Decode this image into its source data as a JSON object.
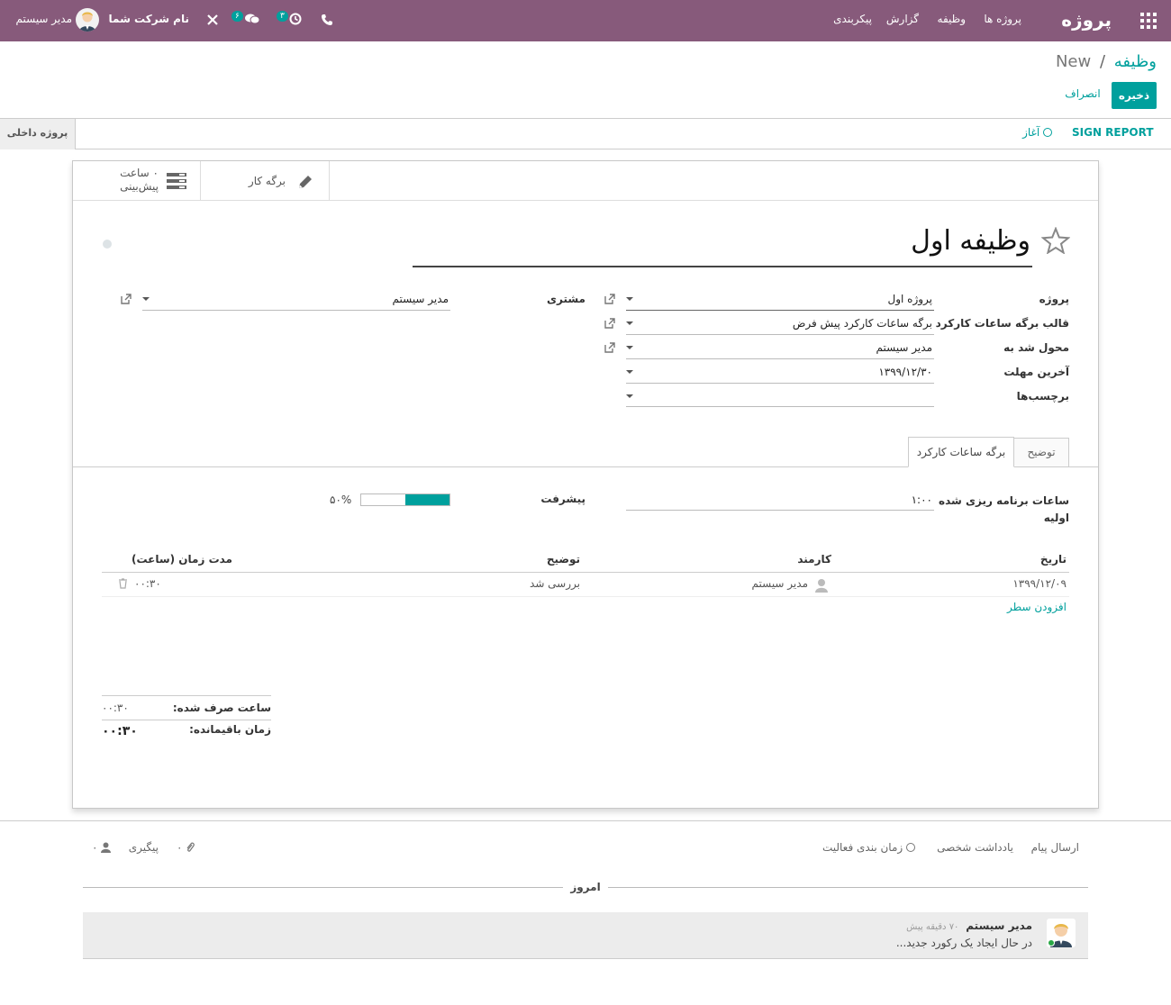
{
  "navbar": {
    "app_title": "پروژه",
    "menu": [
      "پروژه ها",
      "وظیفه",
      "گزارش",
      "پیکربندی"
    ],
    "activity_count": "۳",
    "messages_count": "۶",
    "company": "نام شرکت شما",
    "user": "مدیر سیستم"
  },
  "breadcrumb": {
    "parent": "وظیفه",
    "separator": "/",
    "current": "New"
  },
  "buttons": {
    "save": "ذخیره",
    "discard": "انصراف"
  },
  "statusbar": {
    "sign_report": "SIGN REPORT",
    "start": "آغاز",
    "stage": "پروژه داخلی"
  },
  "smart_buttons": {
    "timesheet": "برگه کار",
    "planned_value": "۰",
    "planned_unit": "ساعت",
    "planned_label": "پیش‌بینی"
  },
  "task": {
    "title": "وظیفه اول"
  },
  "fields": {
    "project_label": "پروژه",
    "project_value": "پروژه اول",
    "template_label": "قالب برگه ساعات کارکرد",
    "template_value": "برگه ساعات کارکرد پیش فرض",
    "assigned_label": "محول شد به",
    "assigned_value": "مدیر سیستم",
    "deadline_label": "آخرین مهلت",
    "deadline_value": "۱۳۹۹/۱۲/۳۰",
    "tags_label": "برچسب‌ها",
    "customer_label": "مشتری",
    "customer_value": "مدیر سیستم"
  },
  "tabs": {
    "description": "توضیح",
    "timesheets": "برگه ساعات کارکرد"
  },
  "timesheet_tab": {
    "planned_label_1": "ساعات برنامه ریزی شده",
    "planned_label_2": "اولیه",
    "planned_value": "۱:۰۰",
    "progress_label": "پیشرفت",
    "progress_text": "۵۰%",
    "progress_fraction": 0.5,
    "columns": [
      "تاریخ",
      "کارمند",
      "توضیح",
      "مدت زمان (ساعت)"
    ],
    "rows": [
      {
        "date": "۱۳۹۹/۱۲/۰۹",
        "employee": "مدیر سیستم",
        "description": "بررسی شد",
        "duration": "۰۰:۳۰"
      }
    ],
    "add_line": "افزودن سطر",
    "spent_label": "ساعت صرف شده:",
    "spent_value": "۰۰:۳۰",
    "remaining_label": "زمان باقیمانده:",
    "remaining_value": "۰۰:۳۰"
  },
  "chatter": {
    "send_message": "ارسال پیام",
    "log_note": "یادداشت شخصی",
    "schedule_activity": "زمان بندی فعالیت",
    "attachments": "۰",
    "follow": "پیگیری",
    "followers": "۰",
    "today": "امروز",
    "message_author": "مدیر سیستم",
    "message_time": "۷۰ دقیقه پیش",
    "message_body": "در حال ایجاد یک رکورد جدید..."
  },
  "colors": {
    "navbar": "#875a7b",
    "accent": "#00a09d"
  }
}
